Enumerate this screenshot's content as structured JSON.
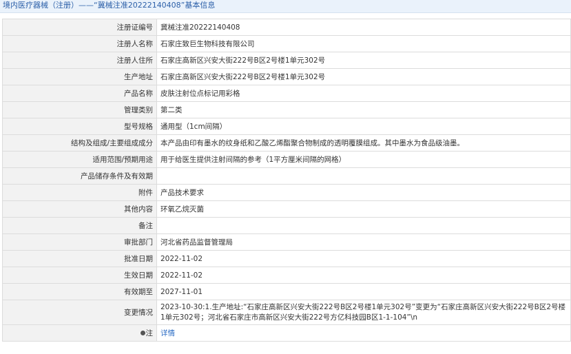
{
  "header": {
    "title": "境内医疗器械（注册）——“冀械注准20222140408”基本信息"
  },
  "rows": [
    {
      "label": "注册证编号",
      "value": "冀械注准20222140408"
    },
    {
      "label": "注册人名称",
      "value": "石家庄致巨生物科技有限公司"
    },
    {
      "label": "注册人住所",
      "value": "石家庄高新区兴安大街222号B区2号楼1单元302号"
    },
    {
      "label": "生产地址",
      "value": "石家庄高新区兴安大街222号B区2号楼1单元302号"
    },
    {
      "label": "产品名称",
      "value": "皮肤注射位点标记用彩格"
    },
    {
      "label": "管理类别",
      "value": "第二类"
    },
    {
      "label": "型号规格",
      "value": "通用型（1cm间隔）"
    },
    {
      "label": "结构及组成/主要组成成分",
      "value": "本产品由印有墨水的纹身纸和乙酸乙烯酯聚合物制成的透明覆膜组成。其中墨水为食品级油墨。"
    },
    {
      "label": "适用范围/预期用途",
      "value": "用于给医生提供注射间隔的参考（1平方厘米间隔的网格）"
    },
    {
      "label": "产品储存条件及有效期",
      "value": ""
    },
    {
      "label": "附件",
      "value": "产品技术要求"
    },
    {
      "label": "其他内容",
      "value": "环氧乙烷灭菌"
    },
    {
      "label": "备注",
      "value": ""
    },
    {
      "label": "审批部门",
      "value": "河北省药品监督管理局"
    },
    {
      "label": "批准日期",
      "value": "2022-11-02"
    },
    {
      "label": "生效日期",
      "value": "2022-11-02"
    },
    {
      "label": "有效期至",
      "value": "2027-11-01"
    },
    {
      "label": "变更情况",
      "value": "2023-10-30:1.生产地址:“石家庄高新区兴安大街222号B区2号楼1单元302号”变更为“石家庄高新区兴安大街222号B区2号楼1单元302号；河北省石家庄市高新区兴安大街222号方亿科技园B区1-1-104”\\n"
    }
  ],
  "note": {
    "label": "注",
    "icon": "pin-icon",
    "link_text": "详情"
  }
}
